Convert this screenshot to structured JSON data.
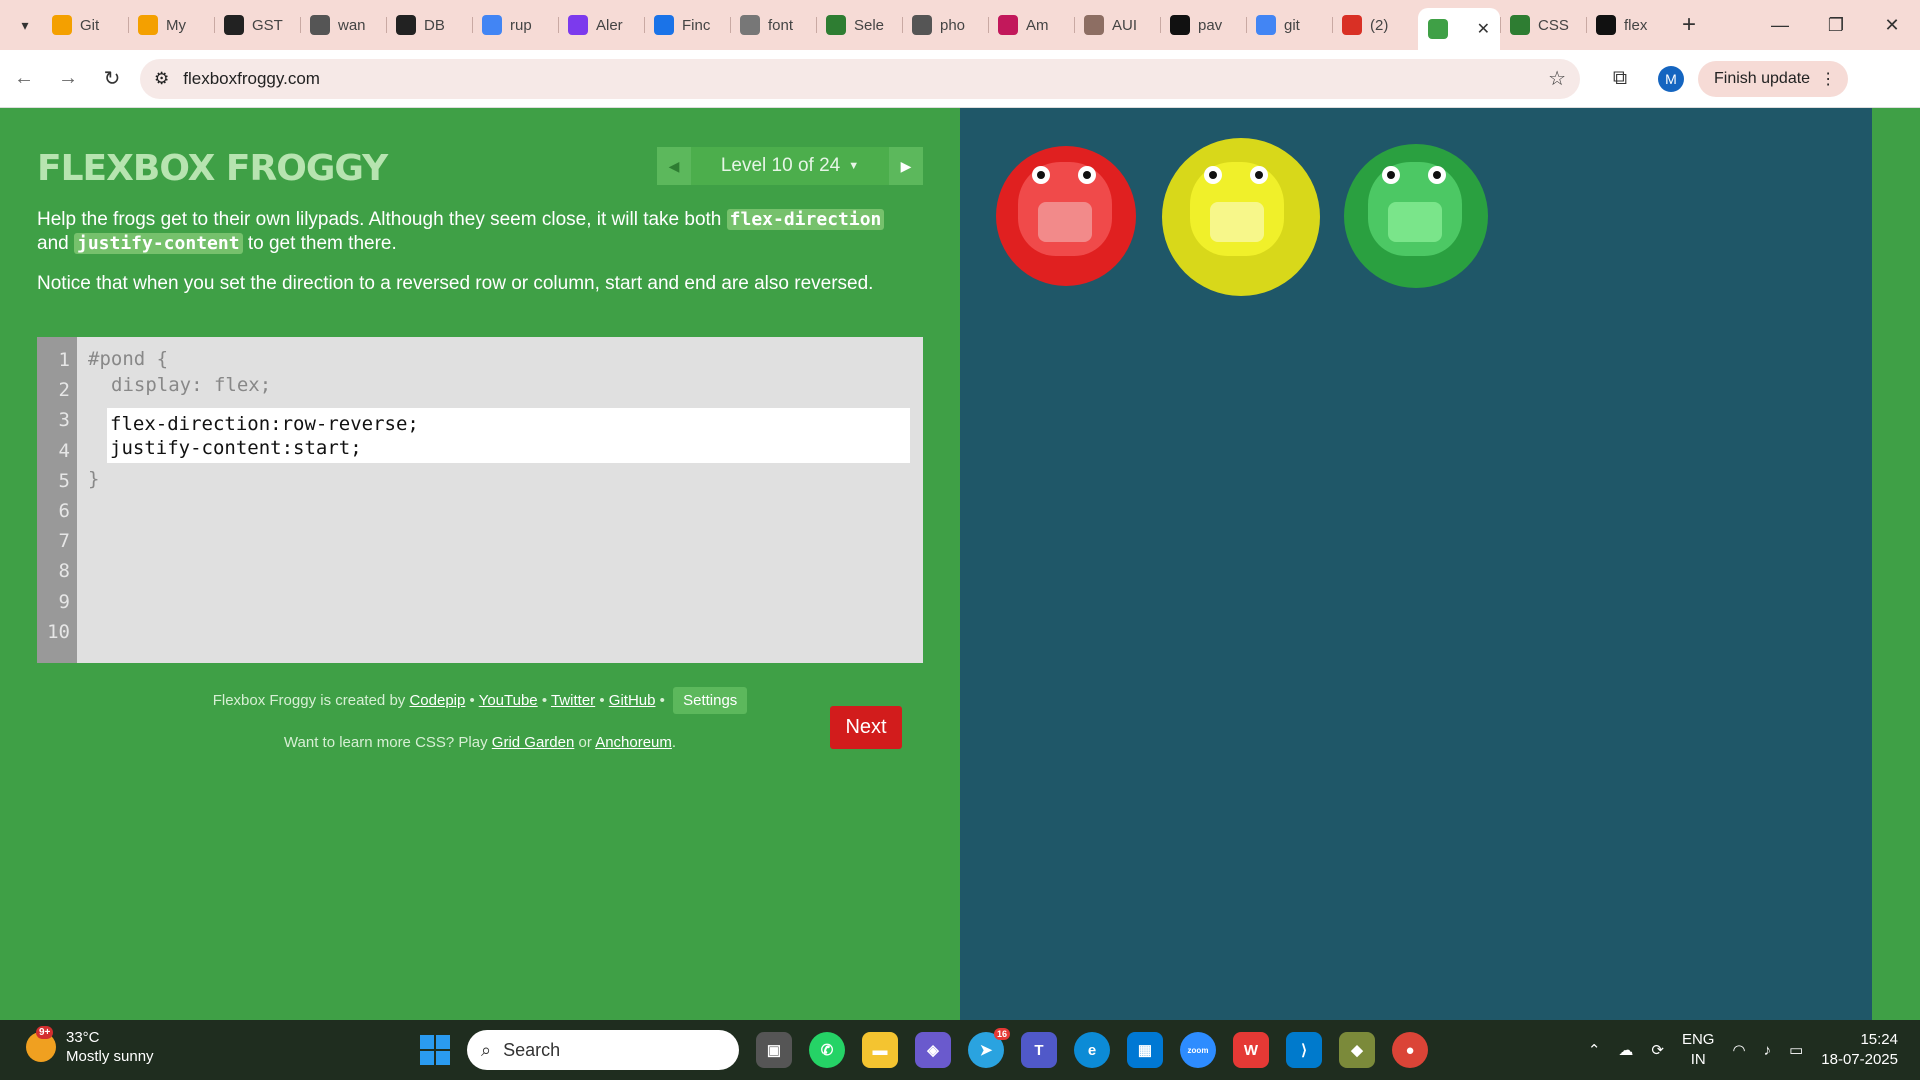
{
  "browser": {
    "tabs": [
      {
        "label": "Git",
        "color": "#f4a000"
      },
      {
        "label": "My",
        "color": "#f4a000"
      },
      {
        "label": "GST",
        "color": "#222222"
      },
      {
        "label": "wan",
        "color": "#555555"
      },
      {
        "label": "DB",
        "color": "#222222"
      },
      {
        "label": "rup",
        "color": "#4285f4"
      },
      {
        "label": "Aler",
        "color": "#7c3aed"
      },
      {
        "label": "Finc",
        "color": "#1a73e8"
      },
      {
        "label": "font",
        "color": "#777777"
      },
      {
        "label": "Sele",
        "color": "#2e7d32"
      },
      {
        "label": "pho",
        "color": "#555555"
      },
      {
        "label": "Am",
        "color": "#c2185b"
      },
      {
        "label": "AUI",
        "color": "#8d6e63"
      },
      {
        "label": "pav",
        "color": "#111111"
      },
      {
        "label": "git",
        "color": "#4285f4"
      },
      {
        "label": "(2)",
        "color": "#d93025"
      },
      {
        "label": "",
        "color": "#3fa046",
        "active": true
      },
      {
        "label": "CSS",
        "color": "#2e7d32"
      },
      {
        "label": "flex",
        "color": "#111111"
      }
    ],
    "url": "flexboxfroggy.com",
    "avatar_letter": "M",
    "finish_update": "Finish update"
  },
  "game": {
    "title": "FLEXBOX FROGGY",
    "level_label": "Level 10 of 24",
    "instructions_1_pre": "Help the frogs get to their own lilypads. Although they seem close, it will take both",
    "instructions_code_1": "flex-direction",
    "instructions_1_mid": "and",
    "instructions_code_2": "justify-content",
    "instructions_1_post": "to get them there.",
    "instructions_2": "Notice that when you set the direction to a reversed row or column, start and end are also reversed.",
    "line_numbers": [
      "1",
      "2",
      "3",
      "4",
      "5",
      "6",
      "7",
      "8",
      "9",
      "10"
    ],
    "code_open": "#pond {",
    "code_display": "display: flex;",
    "input_line_1": "flex-direction:row-reverse;",
    "input_line_2": "justify-content:start;",
    "code_close": "}",
    "next_label": "Next",
    "credits": {
      "prefix": "Flexbox Froggy is created by",
      "codepip": "Codepip",
      "youtube": "YouTube",
      "twitter": "Twitter",
      "github": "GitHub",
      "bullet": "•",
      "settings": "Settings"
    },
    "learn_more": {
      "prefix": "Want to learn more CSS? Play",
      "grid_garden": "Grid Garden",
      "or": "or",
      "anchoreum": "Anchoreum",
      "suffix": "."
    }
  },
  "taskbar": {
    "weather_temp": "33°C",
    "weather_desc": "Mostly sunny",
    "weather_badge": "9+",
    "search_label": "Search",
    "telegram_badge": "16",
    "lang_1": "ENG",
    "lang_2": "IN",
    "time": "15:24",
    "date": "18-07-2025"
  }
}
